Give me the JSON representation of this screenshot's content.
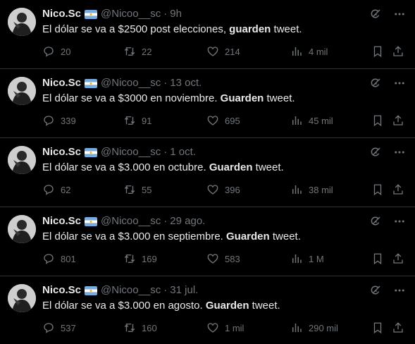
{
  "tweets": [
    {
      "name": "Nico.Sc",
      "handle": "@Nicoo__sc",
      "dot": "·",
      "time": "9h",
      "text_before": "El dólar se va a $2500 post elecciones, ",
      "text_bold": "guarden",
      "text_after": " tweet.",
      "replies": "20",
      "retweets": "22",
      "likes": "214",
      "views": "4 mil"
    },
    {
      "name": "Nico.Sc",
      "handle": "@Nicoo__sc",
      "dot": "·",
      "time": "13 oct.",
      "text_before": "El dólar se va a $3000 en noviembre. ",
      "text_bold": "Guarden",
      "text_after": " tweet.",
      "replies": "339",
      "retweets": "91",
      "likes": "695",
      "views": "45 mil"
    },
    {
      "name": "Nico.Sc",
      "handle": "@Nicoo__sc",
      "dot": "·",
      "time": "1 oct.",
      "text_before": "El dólar se va a $3.000 en octubre. ",
      "text_bold": "Guarden",
      "text_after": " tweet.",
      "replies": "62",
      "retweets": "55",
      "likes": "396",
      "views": "38 mil"
    },
    {
      "name": "Nico.Sc",
      "handle": "@Nicoo__sc",
      "dot": "·",
      "time": "29 ago.",
      "text_before": "El dólar se va a $3.000 en septiembre. ",
      "text_bold": "Guarden",
      "text_after": " tweet.",
      "replies": "801",
      "retweets": "169",
      "likes": "583",
      "views": "1 M"
    },
    {
      "name": "Nico.Sc",
      "handle": "@Nicoo__sc",
      "dot": "·",
      "time": "31 jul.",
      "text_before": "El dólar se va a $3.000 en agosto. ",
      "text_bold": "Guarden",
      "text_after": " tweet.",
      "replies": "537",
      "retweets": "160",
      "likes": "1 mil",
      "views": "290 mil"
    }
  ],
  "icons": {
    "grok": "grok-icon",
    "more": "more-icon",
    "reply": "reply-icon",
    "retweet": "retweet-icon",
    "like": "heart-icon",
    "views": "views-icon",
    "bookmark": "bookmark-icon",
    "share": "share-icon",
    "flag": "argentina-flag-icon"
  },
  "colors": {
    "background": "#000000",
    "text": "#e7e9ea",
    "muted": "#71767b",
    "divider": "#2f3336"
  }
}
